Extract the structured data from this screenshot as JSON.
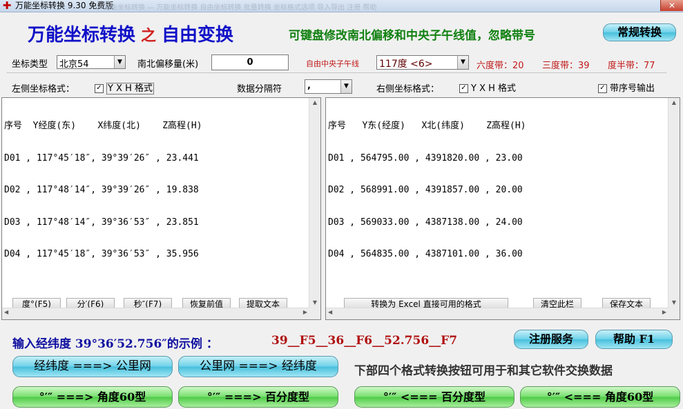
{
  "window": {
    "title": "万能坐标转换 9.30 免费版",
    "ghost_text": "万能坐标转换 — 万能坐标转换   自由坐标转换   批量转换   坐标格式选项   导入导出   注册   帮助",
    "close_label": "✕",
    "app_icon": "plus-icon"
  },
  "header": {
    "title_a": "万能坐标转换",
    "title_zhi": "之",
    "title_b": "自由变换",
    "subtitle": "可键盘修改南北偏移和中央子午线值，忽略带号",
    "normal_button": "常规转换"
  },
  "settings": {
    "coord_type_label": "坐标类型",
    "coord_type_value": "北京54",
    "ns_offset_label": "南北偏移量(米)",
    "ns_offset_value": "0",
    "meridian_label": "自由中央子午线",
    "meridian_value": "117度 <6>",
    "zone6": "六度带：20",
    "zone3": "三度带：39",
    "zone_half": "度半带：77"
  },
  "formats": {
    "left_label": "左侧坐标格式：",
    "left_check": "Y X H 格式",
    "separator_label": "数据分隔符",
    "separator_value": ",",
    "right_label": "右侧坐标格式：",
    "right_check": "Y X H 格式",
    "seq_check": "带序号输出",
    "check_mark": "✓"
  },
  "left_pane": {
    "lines": [
      "序号  Y经度(东)    X纬度(北)    Z高程(H)",
      "D01 , 117°45′18″, 39°39′26″ , 23.441",
      "D02 , 117°48′14″, 39°39′26″ , 19.838",
      "D03 , 117°48′14″, 39°36′53″ , 23.851",
      "D04 , 117°45′18″, 39°36′53″ , 35.956"
    ],
    "buttons": [
      "度°(F5)",
      "分′(F6)",
      "秒″(F7)",
      "恢复前值",
      "提取文本"
    ]
  },
  "right_pane": {
    "lines": [
      "序号   Y东(经度)   X北(纬度)    Z高程(H)",
      "D01 , 564795.00 , 4391820.00 , 23.00",
      "D02 , 568991.00 , 4391857.00 , 20.00",
      "D03 , 569033.00 , 4387138.00 , 24.00",
      "D04 , 564835.00 , 4387101.00 , 36.00"
    ],
    "buttons": [
      "转换为 Excel 直接可用的格式",
      "清空此栏",
      "保存文本"
    ]
  },
  "scroll": {
    "up": "▲",
    "down": "▼",
    "left": "◀",
    "right": "▶",
    "combo_arrow": "▼"
  },
  "bottom": {
    "example_label": "输入经纬度 39°36′52.756″的示例 ：",
    "example_value": "39__F5__36__F6__52.756__F7",
    "register_button": "注册服务",
    "help_button": "帮助 F1",
    "btn_deg_to_km": "经纬度  ===>  公里网",
    "btn_km_to_deg": "公里网  ===>  经纬度",
    "info_text": "下部四个格式转换按钮可用于和其它软件交换数据",
    "btn_dms_to_deg60": "°′″  ===> 角度60型",
    "btn_dms_to_pct": "°′″  ===> 百分度型",
    "btn_pct_to_dms": "°′″  <=== 百分度型",
    "btn_deg60_to_dms": "°′″  <=== 角度60型"
  }
}
